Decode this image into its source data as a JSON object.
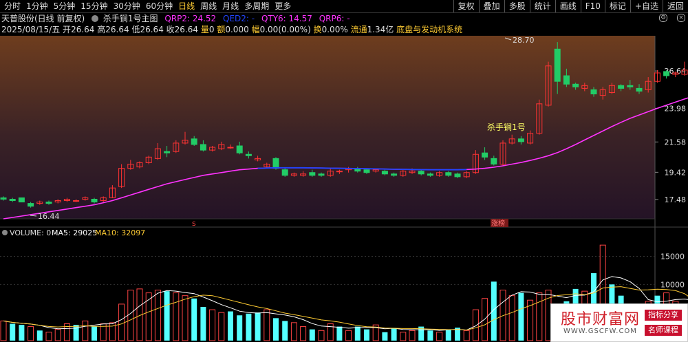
{
  "toolbar": {
    "periods": [
      "分时",
      "1分钟",
      "5分钟",
      "15分钟",
      "30分钟",
      "60分钟",
      "日线",
      "周线",
      "月线",
      "多周期",
      "更多"
    ],
    "active_period": "日线",
    "right_buttons": [
      "复权",
      "叠加",
      "多股",
      "统计",
      "画线",
      "F10",
      "标记",
      "+自选",
      "返回"
    ]
  },
  "title": {
    "stock": "天普股份(日线 前复权)",
    "indicator": "杀手锏1号主图",
    "qrp2_label": "QRP2: ",
    "qrp2_value": "24.52",
    "qed2": "QED2: -",
    "qty6_label": "QTY6: ",
    "qty6_value": "14.57",
    "qrp6": "QRP6: -"
  },
  "info": {
    "date": "2025/08/15/五",
    "open_label": "开",
    "open": "26.64",
    "high_label": "高",
    "high": "26.64",
    "low_label": "低",
    "low": "26.64",
    "close_label": "收",
    "close": "26.64",
    "vol_label": "量",
    "vol": "0",
    "amt_label": "额",
    "amt": "0.000",
    "chg_label": "幅",
    "chg": "0.00(0.00%)",
    "turn_label": "换",
    "turn": "0.00%",
    "float_label": "流通",
    "float": "1.34亿",
    "system": "底盘与发动机系统"
  },
  "price_axis": [
    "26.64",
    "23.98",
    "21.58",
    "19.42",
    "17.48"
  ],
  "volume_axis": [
    "15000",
    "10000"
  ],
  "annotations": {
    "high_mark": "28.70",
    "low_mark": "16.44",
    "signal": "杀手锏1号",
    "s_marker": "s",
    "zt_marker": "涨榜"
  },
  "volume_title": {
    "vol": "VOLUME: 0",
    "ma5": "MA5: 29025",
    "ma10": "MA10: 32097"
  },
  "watermark": {
    "title": "股市财富网",
    "url": "WWW.GSCFW.COM",
    "tag1": "指标分享",
    "tag2": "名师课程"
  },
  "colors": {
    "up": "#ff3333",
    "down": "#22cc66",
    "ma_line": "#ff33ff",
    "blue_line": "#2244ff",
    "vol_up": "#ff4444",
    "vol_down": "#55ffff",
    "accent": "#ffcc33"
  },
  "chart_data": {
    "type": "candlestick",
    "price_range": [
      16.2,
      29.0
    ],
    "candles": [
      [
        17.6,
        17.7,
        17.4,
        17.5
      ],
      [
        17.5,
        17.6,
        17.3,
        17.4
      ],
      [
        17.6,
        17.6,
        17.3,
        17.3
      ],
      [
        17.2,
        17.3,
        16.9,
        17.0
      ],
      [
        17.2,
        17.4,
        17.1,
        17.3
      ],
      [
        17.3,
        17.4,
        17.1,
        17.2
      ],
      [
        17.3,
        17.5,
        17.2,
        17.4
      ],
      [
        17.4,
        17.6,
        17.3,
        17.5
      ],
      [
        17.4,
        17.5,
        17.3,
        17.4
      ],
      [
        17.5,
        17.7,
        17.4,
        17.6
      ],
      [
        17.5,
        17.6,
        17.2,
        17.3
      ],
      [
        17.4,
        17.7,
        17.3,
        17.6
      ],
      [
        17.6,
        18.5,
        17.6,
        18.3
      ],
      [
        18.4,
        20.0,
        18.3,
        19.7
      ],
      [
        19.7,
        20.3,
        19.6,
        20.0
      ],
      [
        19.8,
        20.2,
        19.7,
        20.1
      ],
      [
        20.1,
        20.6,
        20.0,
        20.5
      ],
      [
        20.4,
        21.5,
        20.3,
        21.1
      ],
      [
        20.9,
        21.3,
        20.5,
        20.8
      ],
      [
        20.9,
        21.7,
        20.8,
        21.5
      ],
      [
        21.5,
        22.3,
        21.4,
        21.7
      ],
      [
        21.8,
        22.0,
        21.3,
        21.4
      ],
      [
        21.4,
        21.7,
        20.9,
        21.0
      ],
      [
        21.0,
        21.3,
        20.9,
        21.2
      ],
      [
        21.1,
        21.6,
        21.0,
        21.4
      ],
      [
        21.2,
        21.4,
        21.1,
        21.2
      ],
      [
        21.3,
        21.6,
        20.7,
        20.8
      ],
      [
        20.7,
        20.9,
        20.4,
        20.6
      ],
      [
        20.3,
        20.6,
        20.2,
        20.4
      ],
      [
        19.8,
        20.1,
        19.7,
        20.0
      ],
      [
        20.4,
        20.5,
        19.6,
        19.7
      ],
      [
        19.6,
        19.7,
        19.1,
        19.2
      ],
      [
        19.2,
        19.4,
        19.1,
        19.3
      ],
      [
        19.2,
        19.5,
        19.1,
        19.3
      ],
      [
        19.4,
        19.6,
        19.1,
        19.2
      ],
      [
        19.3,
        19.4,
        19.1,
        19.2
      ],
      [
        19.2,
        19.7,
        19.1,
        19.5
      ],
      [
        19.5,
        19.6,
        19.3,
        19.5
      ],
      [
        19.6,
        19.8,
        19.4,
        19.7
      ],
      [
        19.7,
        19.8,
        19.4,
        19.5
      ],
      [
        19.6,
        19.7,
        19.3,
        19.4
      ],
      [
        19.5,
        19.7,
        19.4,
        19.6
      ],
      [
        19.5,
        19.6,
        19.2,
        19.3
      ],
      [
        19.3,
        19.4,
        19.1,
        19.2
      ],
      [
        19.2,
        19.6,
        19.1,
        19.5
      ],
      [
        19.4,
        19.7,
        19.3,
        19.5
      ],
      [
        19.5,
        19.6,
        19.2,
        19.3
      ],
      [
        19.3,
        19.4,
        19.1,
        19.2
      ],
      [
        19.2,
        19.5,
        19.1,
        19.4
      ],
      [
        19.4,
        19.5,
        19.1,
        19.2
      ],
      [
        19.3,
        19.4,
        19.0,
        19.1
      ],
      [
        19.1,
        19.5,
        19.0,
        19.4
      ],
      [
        19.4,
        21.0,
        19.3,
        20.7
      ],
      [
        20.8,
        21.2,
        20.3,
        20.5
      ],
      [
        20.4,
        20.6,
        19.9,
        20.0
      ],
      [
        20.0,
        21.7,
        19.9,
        21.5
      ],
      [
        21.5,
        22.1,
        21.4,
        21.8
      ],
      [
        21.8,
        22.0,
        21.4,
        21.6
      ],
      [
        21.5,
        22.4,
        21.4,
        22.2
      ],
      [
        22.2,
        24.6,
        22.1,
        24.3
      ],
      [
        24.2,
        27.3,
        24.1,
        27.0
      ],
      [
        28.2,
        28.7,
        25.0,
        25.9
      ],
      [
        26.3,
        26.8,
        25.5,
        25.7
      ],
      [
        25.7,
        25.8,
        25.3,
        25.5
      ],
      [
        25.4,
        25.8,
        25.2,
        25.6
      ],
      [
        25.3,
        25.5,
        24.8,
        25.0
      ],
      [
        24.9,
        25.5,
        24.6,
        25.3
      ],
      [
        25.1,
        25.8,
        25.0,
        25.6
      ],
      [
        25.6,
        25.7,
        25.2,
        25.4
      ],
      [
        25.6,
        26.0,
        25.3,
        25.5
      ],
      [
        25.4,
        25.7,
        25.0,
        25.2
      ],
      [
        25.3,
        26.2,
        25.1,
        25.9
      ],
      [
        25.9,
        26.7,
        25.8,
        26.5
      ],
      [
        26.6,
        26.7,
        26.1,
        26.3
      ],
      [
        26.4,
        26.6,
        26.2,
        26.5
      ],
      [
        26.4,
        27.3,
        26.3,
        26.7
      ]
    ],
    "ma": [
      16.1,
      16.2,
      16.3,
      16.4,
      16.5,
      16.6,
      16.7,
      16.8,
      16.9,
      17.0,
      17.1,
      17.25,
      17.4,
      17.6,
      17.8,
      18.0,
      18.2,
      18.4,
      18.6,
      18.75,
      18.9,
      19.05,
      19.2,
      19.3,
      19.4,
      19.5,
      19.6,
      19.65,
      19.7,
      19.72,
      19.74,
      19.74,
      19.74,
      19.74,
      19.73,
      19.72,
      19.71,
      19.7,
      19.69,
      19.68,
      19.67,
      19.66,
      19.65,
      19.64,
      19.63,
      19.62,
      19.61,
      19.6,
      19.6,
      19.6,
      19.6,
      19.62,
      19.65,
      19.7,
      19.78,
      19.88,
      20.0,
      20.12,
      20.26,
      20.42,
      20.6,
      20.82,
      21.1,
      21.4,
      21.72,
      22.04,
      22.36,
      22.68,
      22.98,
      23.26,
      23.5,
      23.74,
      23.98,
      24.2,
      24.42,
      24.64,
      24.84
    ],
    "volume": [
      3500,
      3000,
      2800,
      2500,
      1800,
      1500,
      2000,
      3000,
      2800,
      3500,
      2500,
      3000,
      3200,
      6500,
      9000,
      9200,
      8500,
      9000,
      8800,
      8500,
      8000,
      7500,
      6000,
      5500,
      5000,
      5200,
      4500,
      4800,
      5000,
      5500,
      4000,
      3500,
      3200,
      2500,
      2000,
      1800,
      3000,
      2500,
      1800,
      2500,
      2000,
      2800,
      1500,
      2200,
      1500,
      1800,
      2500,
      1800,
      1500,
      2000,
      2300,
      1800,
      5500,
      7500,
      10500,
      9000,
      8000,
      8500,
      7200,
      8500,
      9000,
      6500,
      7000,
      9200,
      8800,
      12000,
      17000,
      10000,
      8000,
      5500,
      6000,
      7000,
      8000,
      8500,
      7000,
      6500,
      6000
    ],
    "volume_up_flags": [
      1,
      0,
      0,
      1,
      0,
      1,
      1,
      1,
      0,
      1,
      0,
      1,
      1,
      1,
      1,
      1,
      1,
      1,
      0,
      1,
      1,
      0,
      0,
      1,
      1,
      0,
      0,
      0,
      0,
      1,
      0,
      0,
      1,
      1,
      0,
      1,
      1,
      0,
      1,
      0,
      0,
      1,
      0,
      0,
      1,
      1,
      0,
      0,
      1,
      0,
      0,
      1,
      1,
      1,
      0,
      1,
      1,
      0,
      1,
      1,
      1,
      0,
      0,
      0,
      1,
      0,
      1,
      0,
      0,
      0,
      1,
      1,
      0,
      1,
      1,
      1,
      1
    ]
  }
}
